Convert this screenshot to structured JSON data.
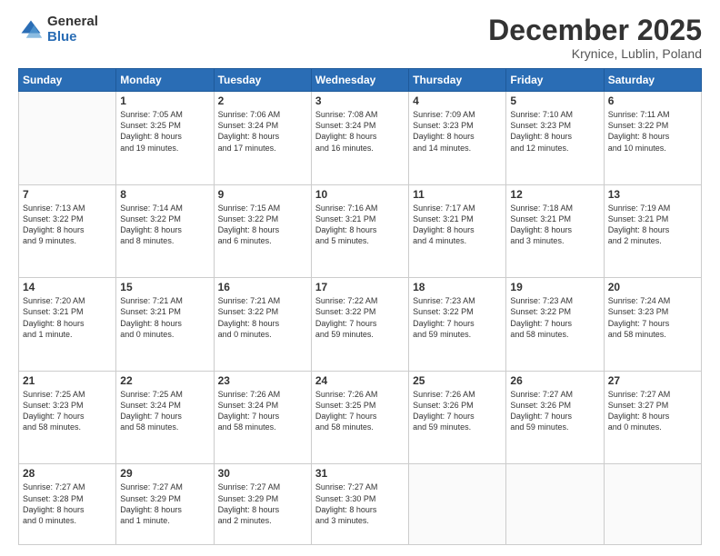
{
  "logo": {
    "general": "General",
    "blue": "Blue"
  },
  "header": {
    "month": "December 2025",
    "location": "Krynice, Lublin, Poland"
  },
  "weekdays": [
    "Sunday",
    "Monday",
    "Tuesday",
    "Wednesday",
    "Thursday",
    "Friday",
    "Saturday"
  ],
  "weeks": [
    [
      {
        "day": "",
        "content": ""
      },
      {
        "day": "1",
        "content": "Sunrise: 7:05 AM\nSunset: 3:25 PM\nDaylight: 8 hours\nand 19 minutes."
      },
      {
        "day": "2",
        "content": "Sunrise: 7:06 AM\nSunset: 3:24 PM\nDaylight: 8 hours\nand 17 minutes."
      },
      {
        "day": "3",
        "content": "Sunrise: 7:08 AM\nSunset: 3:24 PM\nDaylight: 8 hours\nand 16 minutes."
      },
      {
        "day": "4",
        "content": "Sunrise: 7:09 AM\nSunset: 3:23 PM\nDaylight: 8 hours\nand 14 minutes."
      },
      {
        "day": "5",
        "content": "Sunrise: 7:10 AM\nSunset: 3:23 PM\nDaylight: 8 hours\nand 12 minutes."
      },
      {
        "day": "6",
        "content": "Sunrise: 7:11 AM\nSunset: 3:22 PM\nDaylight: 8 hours\nand 10 minutes."
      }
    ],
    [
      {
        "day": "7",
        "content": "Sunrise: 7:13 AM\nSunset: 3:22 PM\nDaylight: 8 hours\nand 9 minutes."
      },
      {
        "day": "8",
        "content": "Sunrise: 7:14 AM\nSunset: 3:22 PM\nDaylight: 8 hours\nand 8 minutes."
      },
      {
        "day": "9",
        "content": "Sunrise: 7:15 AM\nSunset: 3:22 PM\nDaylight: 8 hours\nand 6 minutes."
      },
      {
        "day": "10",
        "content": "Sunrise: 7:16 AM\nSunset: 3:21 PM\nDaylight: 8 hours\nand 5 minutes."
      },
      {
        "day": "11",
        "content": "Sunrise: 7:17 AM\nSunset: 3:21 PM\nDaylight: 8 hours\nand 4 minutes."
      },
      {
        "day": "12",
        "content": "Sunrise: 7:18 AM\nSunset: 3:21 PM\nDaylight: 8 hours\nand 3 minutes."
      },
      {
        "day": "13",
        "content": "Sunrise: 7:19 AM\nSunset: 3:21 PM\nDaylight: 8 hours\nand 2 minutes."
      }
    ],
    [
      {
        "day": "14",
        "content": "Sunrise: 7:20 AM\nSunset: 3:21 PM\nDaylight: 8 hours\nand 1 minute."
      },
      {
        "day": "15",
        "content": "Sunrise: 7:21 AM\nSunset: 3:21 PM\nDaylight: 8 hours\nand 0 minutes."
      },
      {
        "day": "16",
        "content": "Sunrise: 7:21 AM\nSunset: 3:22 PM\nDaylight: 8 hours\nand 0 minutes."
      },
      {
        "day": "17",
        "content": "Sunrise: 7:22 AM\nSunset: 3:22 PM\nDaylight: 7 hours\nand 59 minutes."
      },
      {
        "day": "18",
        "content": "Sunrise: 7:23 AM\nSunset: 3:22 PM\nDaylight: 7 hours\nand 59 minutes."
      },
      {
        "day": "19",
        "content": "Sunrise: 7:23 AM\nSunset: 3:22 PM\nDaylight: 7 hours\nand 58 minutes."
      },
      {
        "day": "20",
        "content": "Sunrise: 7:24 AM\nSunset: 3:23 PM\nDaylight: 7 hours\nand 58 minutes."
      }
    ],
    [
      {
        "day": "21",
        "content": "Sunrise: 7:25 AM\nSunset: 3:23 PM\nDaylight: 7 hours\nand 58 minutes."
      },
      {
        "day": "22",
        "content": "Sunrise: 7:25 AM\nSunset: 3:24 PM\nDaylight: 7 hours\nand 58 minutes."
      },
      {
        "day": "23",
        "content": "Sunrise: 7:26 AM\nSunset: 3:24 PM\nDaylight: 7 hours\nand 58 minutes."
      },
      {
        "day": "24",
        "content": "Sunrise: 7:26 AM\nSunset: 3:25 PM\nDaylight: 7 hours\nand 58 minutes."
      },
      {
        "day": "25",
        "content": "Sunrise: 7:26 AM\nSunset: 3:26 PM\nDaylight: 7 hours\nand 59 minutes."
      },
      {
        "day": "26",
        "content": "Sunrise: 7:27 AM\nSunset: 3:26 PM\nDaylight: 7 hours\nand 59 minutes."
      },
      {
        "day": "27",
        "content": "Sunrise: 7:27 AM\nSunset: 3:27 PM\nDaylight: 8 hours\nand 0 minutes."
      }
    ],
    [
      {
        "day": "28",
        "content": "Sunrise: 7:27 AM\nSunset: 3:28 PM\nDaylight: 8 hours\nand 0 minutes."
      },
      {
        "day": "29",
        "content": "Sunrise: 7:27 AM\nSunset: 3:29 PM\nDaylight: 8 hours\nand 1 minute."
      },
      {
        "day": "30",
        "content": "Sunrise: 7:27 AM\nSunset: 3:29 PM\nDaylight: 8 hours\nand 2 minutes."
      },
      {
        "day": "31",
        "content": "Sunrise: 7:27 AM\nSunset: 3:30 PM\nDaylight: 8 hours\nand 3 minutes."
      },
      {
        "day": "",
        "content": ""
      },
      {
        "day": "",
        "content": ""
      },
      {
        "day": "",
        "content": ""
      }
    ]
  ]
}
